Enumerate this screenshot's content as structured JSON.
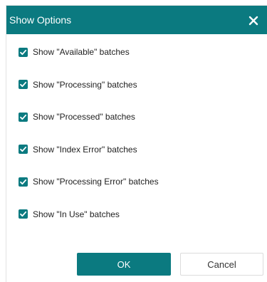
{
  "dialog": {
    "title": "Show Options",
    "accent_color": "#0b7a80",
    "close_icon": "close-icon"
  },
  "options": [
    {
      "label": "Show \"Available\" batches",
      "checked": true
    },
    {
      "label": "Show \"Processing\" batches",
      "checked": true
    },
    {
      "label": "Show \"Processed\" batches",
      "checked": true
    },
    {
      "label": "Show \"Index Error\" batches",
      "checked": true
    },
    {
      "label": "Show \"Processing Error\" batches",
      "checked": true
    },
    {
      "label": "Show \"In Use\" batches",
      "checked": true
    }
  ],
  "buttons": {
    "ok": "OK",
    "cancel": "Cancel"
  }
}
